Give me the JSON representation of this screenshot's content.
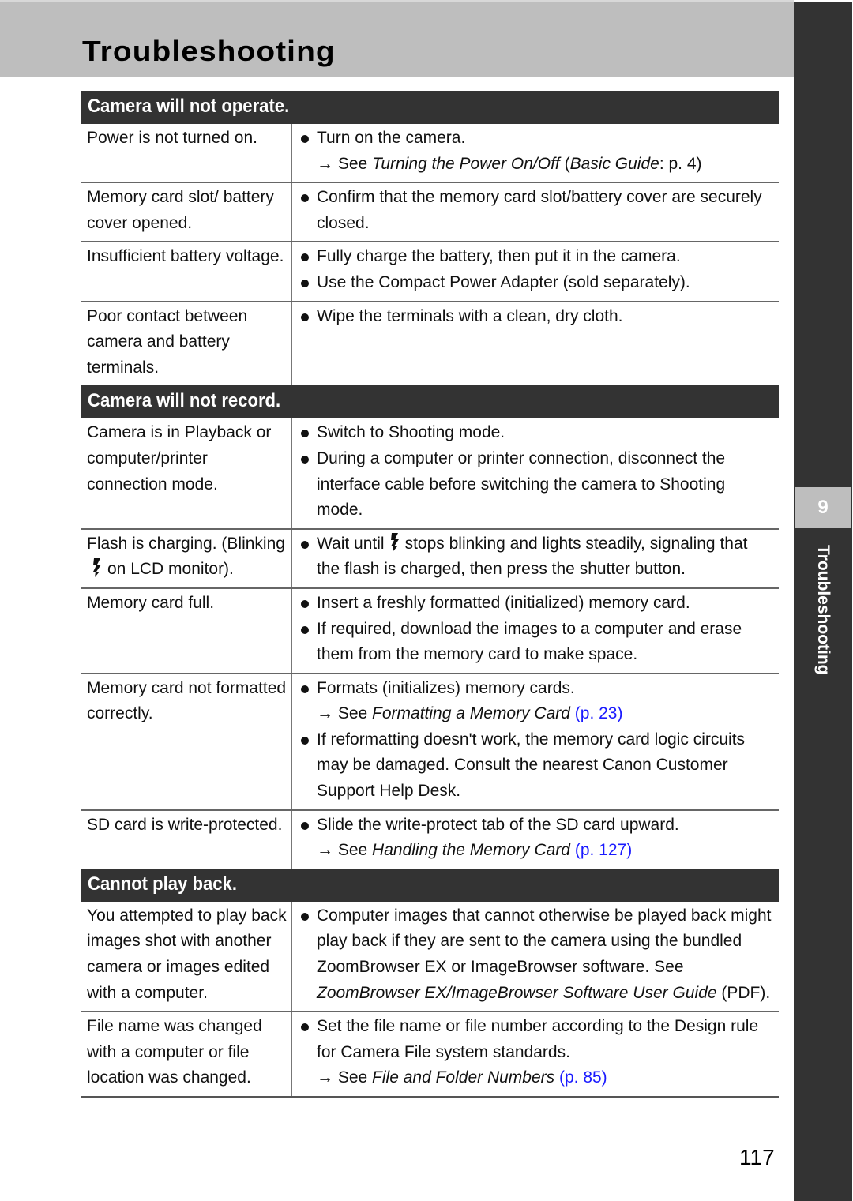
{
  "page": {
    "title": "Troubleshooting",
    "page_number": "117",
    "side_tab": {
      "chapter": "9",
      "label": "Troubleshooting"
    }
  },
  "sections": [
    {
      "heading": "Camera will not operate.",
      "rows": [
        {
          "cause": "Power is not turned on.",
          "bullets": [
            "Turn on the camera."
          ],
          "ref": {
            "prefix": "→ See ",
            "title": "Turning the Power On/Off",
            "mid": " (",
            "title2": "Basic Guide",
            "suffix": ": p. 4)"
          }
        },
        {
          "cause": "Memory card slot/ battery cover opened.",
          "bullets": [
            "Confirm that the memory card slot/battery cover are securely closed."
          ]
        },
        {
          "cause": "Insufficient battery voltage.",
          "bullets": [
            "Fully charge the battery, then put it in the camera.",
            "Use the Compact Power Adapter (sold separately)."
          ]
        },
        {
          "cause": "Poor contact between camera and battery terminals.",
          "bullets": [
            "Wipe the terminals with a clean, dry cloth."
          ]
        }
      ]
    },
    {
      "heading": "Camera will not record.",
      "rows": [
        {
          "cause": "Camera is in Playback or computer/printer connection mode.",
          "bullets": [
            "Switch to Shooting mode.",
            "During a computer or printer connection, disconnect the interface cable before switching the camera to Shooting mode."
          ]
        },
        {
          "cause_a": "Flash is charging. (Blinking",
          "cause_b": "on LCD monitor).",
          "bullet_a": "Wait until",
          "bullet_b": "stops blinking and lights steadily, signaling that the flash is charged, then press the shutter button."
        },
        {
          "cause": "Memory card full.",
          "bullets": [
            "Insert a freshly formatted (initialized) memory card.",
            "If required, download the images to a computer and erase them from the memory card to make space."
          ]
        },
        {
          "cause": "Memory card not formatted correctly.",
          "bullets": [
            "Formats (initializes) memory cards.",
            "If reformatting doesn't work, the memory card logic circuits may be damaged. Consult the nearest Canon Customer Support Help Desk."
          ],
          "ref": {
            "prefix": "→ See ",
            "title": "Formatting a Memory Card",
            "link": " (p. 23)"
          }
        },
        {
          "cause": "SD card is write-protected.",
          "bullets": [
            "Slide the write-protect tab of the SD card upward."
          ],
          "ref": {
            "prefix": "→ See ",
            "title": "Handling the Memory Card",
            "link": " (p. 127)"
          }
        }
      ]
    },
    {
      "heading": "Cannot play back.",
      "rows": [
        {
          "cause": "You attempted to play back images shot with another camera or images edited with a computer.",
          "bullet_a": "Computer images that cannot otherwise be played back might play back if they are sent to the camera using the bundled ZoomBrowser EX or ImageBrowser software. See ",
          "bullet_title": "ZoomBrowser EX/ImageBrowser Software User Guide",
          "bullet_b": " (PDF)."
        },
        {
          "cause": "File name was changed with a computer or file location was changed.",
          "bullets": [
            "Set the file name or file number according to the Design rule for Camera File system standards."
          ],
          "ref": {
            "prefix": "→ See ",
            "title": "File and Folder Numbers",
            "link": " (p. 85)"
          }
        }
      ]
    }
  ],
  "colors": {
    "link": "#1a1aff",
    "section_bg": "#333333",
    "header_band": "#bebebe"
  }
}
